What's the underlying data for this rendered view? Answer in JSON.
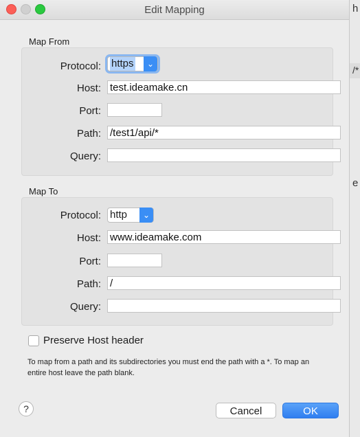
{
  "window": {
    "title": "Edit Mapping"
  },
  "background_app": {
    "fragment_1": "h",
    "fragment_2": "/*",
    "fragment_3": "e"
  },
  "map_from": {
    "section_label": "Map From",
    "protocol_label": "Protocol:",
    "protocol_value": "https",
    "host_label": "Host:",
    "host_value": "test.ideamake.cn",
    "port_label": "Port:",
    "port_value": "",
    "path_label": "Path:",
    "path_value": "/test1/api/*",
    "query_label": "Query:",
    "query_value": ""
  },
  "map_to": {
    "section_label": "Map To",
    "protocol_label": "Protocol:",
    "protocol_value": "http",
    "host_label": "Host:",
    "host_value": "www.ideamake.com",
    "port_label": "Port:",
    "port_value": "",
    "path_label": "Path:",
    "path_value": "/",
    "query_label": "Query:",
    "query_value": ""
  },
  "preserve_host": {
    "label": "Preserve Host header",
    "checked": false
  },
  "hint": "To map from a path and its subdirectories you must end the path with a *. To map an entire host leave the path blank.",
  "buttons": {
    "help": "?",
    "cancel": "Cancel",
    "ok": "OK"
  },
  "colors": {
    "accent": "#3a8ef5",
    "close": "#fc5f57",
    "maximize": "#2ac940"
  },
  "icons": {
    "select_chevron": "chevron-down-icon"
  }
}
